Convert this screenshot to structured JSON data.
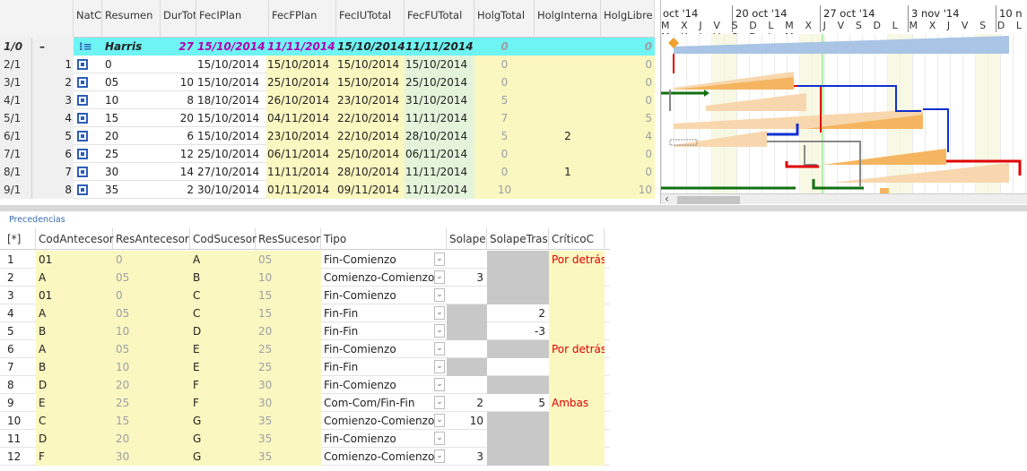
{
  "top_grid": {
    "headers": [
      "NatC",
      "Resumen",
      "DurTot",
      "FecIPlan",
      "FecFPlan",
      "FecIUTotal",
      "FecFUTotal",
      "HolgTotal",
      "HolgInterna",
      "HolgLibre"
    ],
    "summary": {
      "row": "1/0",
      "minus": "–",
      "name": "Harris",
      "dur": "27",
      "ip": "15/10/2014",
      "fp": "11/11/2014",
      "iu": "15/10/2014",
      "fu": "11/11/2014",
      "ht": "0",
      "hl": "0"
    },
    "rows": [
      {
        "row": "2/1",
        "id": "1",
        "name": "0",
        "dur": "",
        "ip": "15/10/2014",
        "fp": "15/10/2014",
        "iu": "15/10/2014",
        "fu": "15/10/2014",
        "ht": "0",
        "hi": "",
        "hl": "0"
      },
      {
        "row": "3/1",
        "id": "2",
        "name": "05",
        "dur": "10",
        "ip": "15/10/2014",
        "fp": "25/10/2014",
        "iu": "15/10/2014",
        "fu": "25/10/2014",
        "ht": "0",
        "hi": "",
        "hl": "0"
      },
      {
        "row": "4/1",
        "id": "3",
        "name": "10",
        "dur": "8",
        "ip": "18/10/2014",
        "fp": "26/10/2014",
        "iu": "23/10/2014",
        "fu": "31/10/2014",
        "ht": "5",
        "hi": "",
        "hl": "0"
      },
      {
        "row": "5/1",
        "id": "4",
        "name": "15",
        "dur": "20",
        "ip": "15/10/2014",
        "fp": "04/11/2014",
        "iu": "22/10/2014",
        "fu": "11/11/2014",
        "ht": "7",
        "hi": "",
        "hl": "5"
      },
      {
        "row": "6/1",
        "id": "5",
        "name": "20",
        "dur": "6",
        "ip": "15/10/2014",
        "fp": "23/10/2014",
        "iu": "22/10/2014",
        "fu": "28/10/2014",
        "ht": "5",
        "hi": "2",
        "hl": "4"
      },
      {
        "row": "7/1",
        "id": "6",
        "name": "25",
        "dur": "12",
        "ip": "25/10/2014",
        "fp": "06/11/2014",
        "iu": "25/10/2014",
        "fu": "06/11/2014",
        "ht": "0",
        "hi": "",
        "hl": "0"
      },
      {
        "row": "8/1",
        "id": "7",
        "name": "30",
        "dur": "14",
        "ip": "27/10/2014",
        "fp": "11/11/2014",
        "iu": "28/10/2014",
        "fu": "11/11/2014",
        "ht": "0",
        "hi": "1",
        "hl": "0"
      },
      {
        "row": "9/1",
        "id": "8",
        "name": "35",
        "dur": "2",
        "ip": "30/10/2014",
        "fp": "01/11/2014",
        "iu": "09/11/2014",
        "fu": "11/11/2014",
        "ht": "10",
        "hi": "",
        "hl": "10"
      }
    ]
  },
  "gantt": {
    "weeks": [
      "oct '14",
      "20 oct '14",
      "27 oct '14",
      "3 nov '14",
      "10 n"
    ],
    "days": "M X J V S D L M X J V S D L M X J V S D L M X J V S D L M",
    "scroll_left": "‹"
  },
  "precedencias": {
    "title": "Precedencias",
    "corner": "[*]",
    "headers": [
      "CodAntecesor",
      "ResAntecesor",
      "CodSucesor",
      "ResSucesor",
      "Tipo",
      "Solape",
      "SolapeTras",
      "CríticoC"
    ],
    "rows": [
      {
        "n": "1",
        "ca": "01",
        "ra": "0",
        "cs": "A",
        "rs": "05",
        "tipo": "Fin-Comienzo",
        "sol": "",
        "st": "",
        "crit": "Por detrás",
        "solg": false,
        "stg": true
      },
      {
        "n": "2",
        "ca": "A",
        "ra": "05",
        "cs": "B",
        "rs": "10",
        "tipo": "Comienzo-Comienzo",
        "sol": "3",
        "st": "",
        "crit": "",
        "solg": false,
        "stg": true
      },
      {
        "n": "3",
        "ca": "01",
        "ra": "0",
        "cs": "C",
        "rs": "15",
        "tipo": "Fin-Comienzo",
        "sol": "",
        "st": "",
        "crit": "",
        "solg": false,
        "stg": true
      },
      {
        "n": "4",
        "ca": "A",
        "ra": "05",
        "cs": "C",
        "rs": "15",
        "tipo": "Fin-Fin",
        "sol": "",
        "st": "2",
        "crit": "",
        "solg": true,
        "stg": false
      },
      {
        "n": "5",
        "ca": "B",
        "ra": "10",
        "cs": "D",
        "rs": "20",
        "tipo": "Fin-Fin",
        "sol": "",
        "st": "-3",
        "crit": "",
        "solg": true,
        "stg": false
      },
      {
        "n": "6",
        "ca": "A",
        "ra": "05",
        "cs": "E",
        "rs": "25",
        "tipo": "Fin-Comienzo",
        "sol": "",
        "st": "",
        "crit": "Por detrás",
        "solg": false,
        "stg": true
      },
      {
        "n": "7",
        "ca": "B",
        "ra": "10",
        "cs": "E",
        "rs": "25",
        "tipo": "Fin-Fin",
        "sol": "",
        "st": "",
        "crit": "",
        "solg": true,
        "stg": false
      },
      {
        "n": "8",
        "ca": "D",
        "ra": "20",
        "cs": "F",
        "rs": "30",
        "tipo": "Fin-Comienzo",
        "sol": "",
        "st": "",
        "crit": "",
        "solg": false,
        "stg": true
      },
      {
        "n": "9",
        "ca": "E",
        "ra": "25",
        "cs": "F",
        "rs": "30",
        "tipo": "Com-Com/Fin-Fin",
        "sol": "2",
        "st": "5",
        "crit": "Ambas",
        "solg": false,
        "stg": false
      },
      {
        "n": "10",
        "ca": "C",
        "ra": "15",
        "cs": "G",
        "rs": "35",
        "tipo": "Comienzo-Comienzo",
        "sol": "10",
        "st": "",
        "crit": "",
        "solg": false,
        "stg": true
      },
      {
        "n": "11",
        "ca": "D",
        "ra": "20",
        "cs": "G",
        "rs": "35",
        "tipo": "Fin-Comienzo",
        "sol": "",
        "st": "",
        "crit": "",
        "solg": false,
        "stg": true
      },
      {
        "n": "12",
        "ca": "F",
        "ra": "30",
        "cs": "G",
        "rs": "35",
        "tipo": "Comienzo-Comienzo",
        "sol": "3",
        "st": "",
        "crit": "",
        "solg": false,
        "stg": true
      }
    ]
  },
  "colors": {
    "summary": "#6ff4f4",
    "yellow": "#fbf7c0",
    "critical_red": "#e00000",
    "bar_orange": "#f5b560",
    "link_blue": "#1030d0",
    "link_green": "#107010"
  }
}
